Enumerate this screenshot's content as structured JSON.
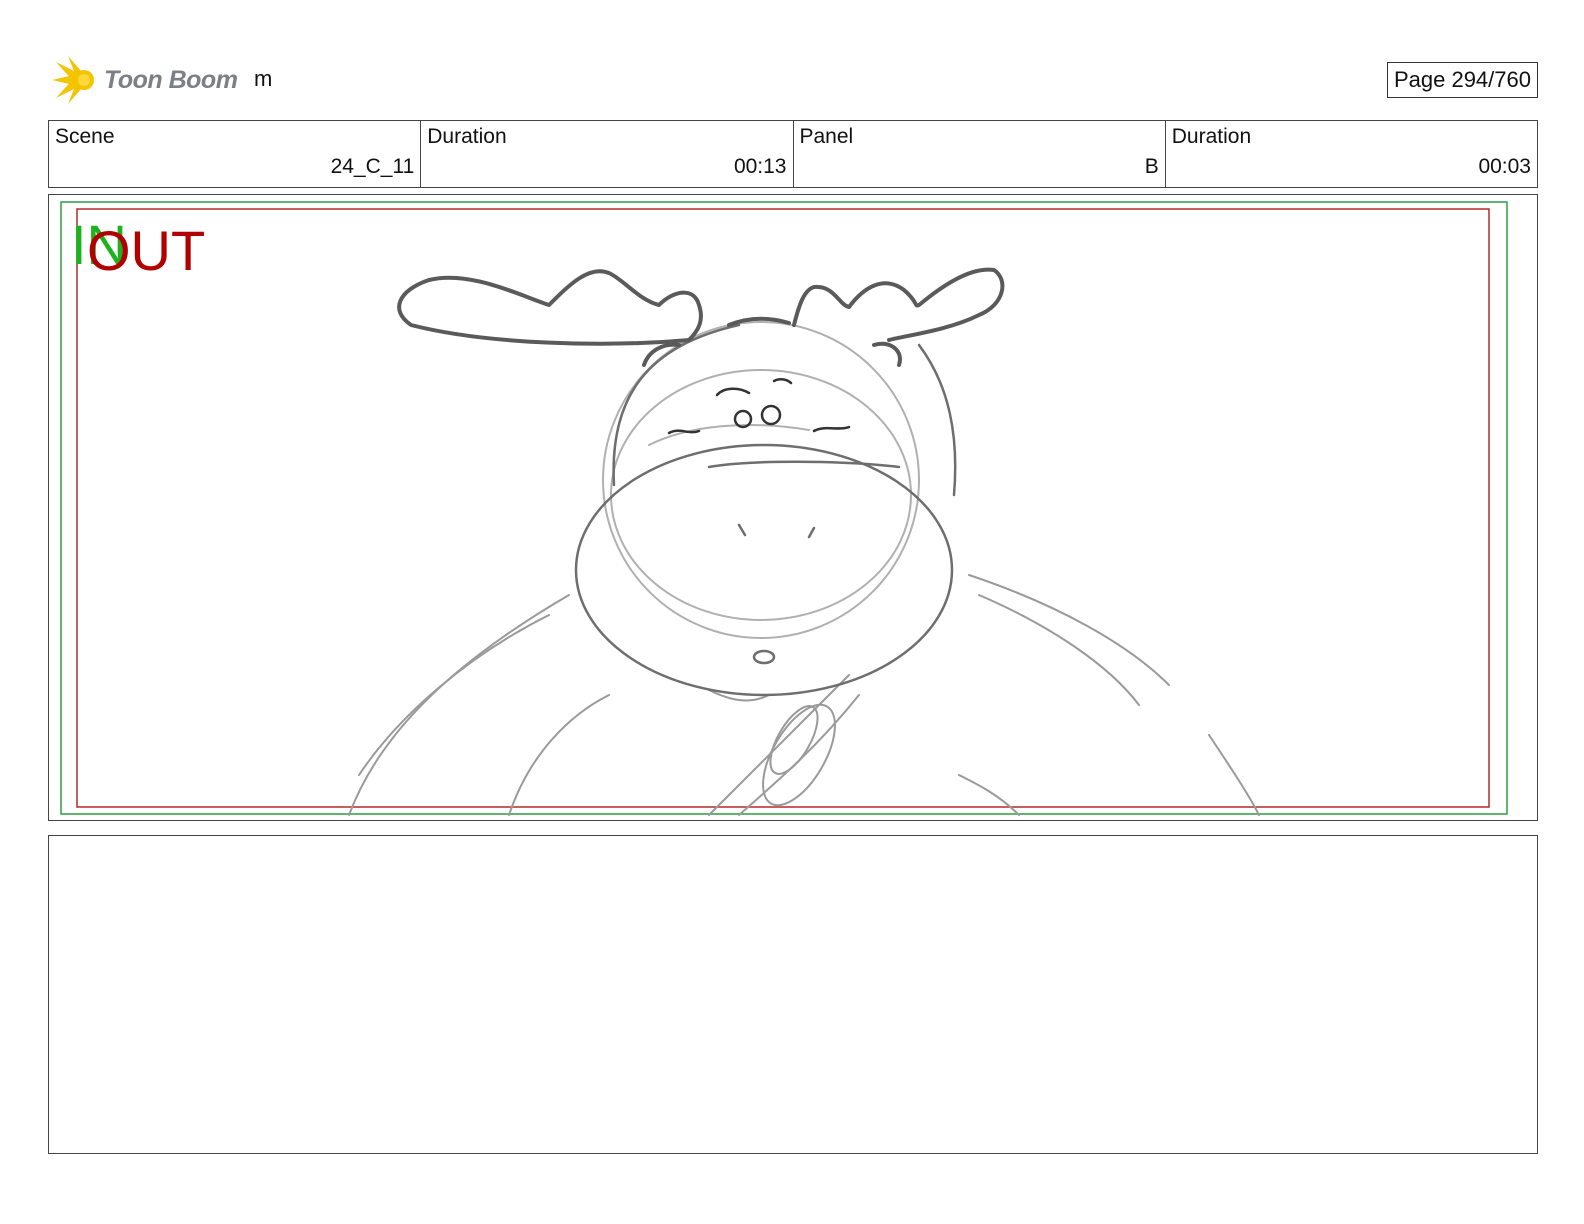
{
  "header": {
    "logo_text": "Toon Boom",
    "project_name": "m",
    "page_label": "Page 294/760"
  },
  "info": {
    "scene_label": "Scene",
    "scene_value": "24_C_11",
    "scene_duration_label": "Duration",
    "scene_duration_value": "00:13",
    "panel_label": "Panel",
    "panel_value": "B",
    "panel_duration_label": "Duration",
    "panel_duration_value": "00:03"
  },
  "panel": {
    "in_label": "IN",
    "out_label": "OUT",
    "in_color": "#1db31d",
    "out_color": "#b00000"
  },
  "colors": {
    "logo_yellow": "#f5c400",
    "logo_text": "#7b7f86",
    "safe_frame_green": "#2e9b3e",
    "safe_frame_red": "#b32a2a"
  }
}
